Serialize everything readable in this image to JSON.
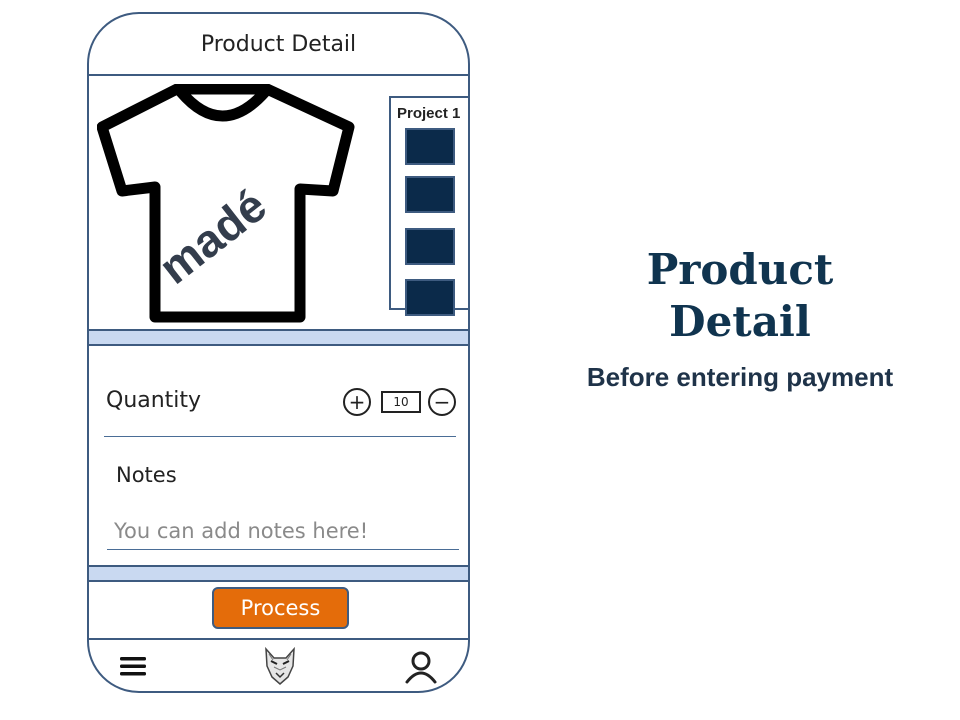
{
  "header": {
    "title": "Product Detail"
  },
  "product": {
    "logo_text": "madé"
  },
  "swatch_panel": {
    "title": "Project 1",
    "swatch_color": "#0b2a4a",
    "swatch_count": 4
  },
  "quantity": {
    "label": "Quantity",
    "value": "10",
    "increment_label": "+",
    "decrement_label": "−"
  },
  "notes": {
    "label": "Notes",
    "placeholder": "You can add notes here!"
  },
  "actions": {
    "process_label": "Process",
    "process_color": "#e46c0a"
  },
  "bottom_nav": {
    "icons": [
      "menu-icon",
      "wolf-logo-icon",
      "user-profile-icon"
    ]
  },
  "side": {
    "title": "Product Detail",
    "subtitle": "Before entering payment"
  },
  "colors": {
    "frame": "#3e5b80",
    "band": "#c9d9f1",
    "title": "#10344f"
  }
}
